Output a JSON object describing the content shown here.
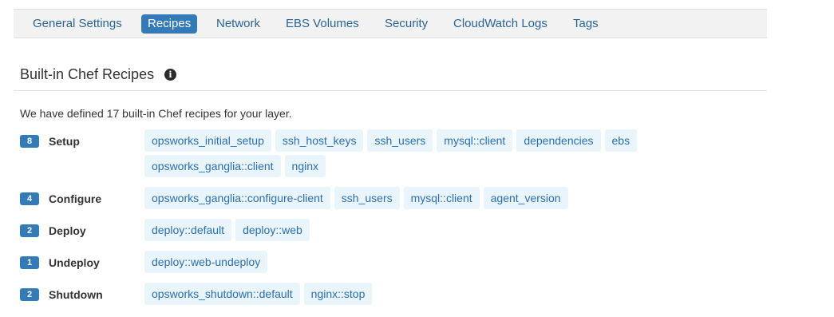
{
  "tabs": [
    {
      "label": "General Settings",
      "active": false
    },
    {
      "label": "Recipes",
      "active": true
    },
    {
      "label": "Network",
      "active": false
    },
    {
      "label": "EBS Volumes",
      "active": false
    },
    {
      "label": "Security",
      "active": false
    },
    {
      "label": "CloudWatch Logs",
      "active": false
    },
    {
      "label": "Tags",
      "active": false
    }
  ],
  "section": {
    "title": "Built-in Chef Recipes",
    "info_icon": "info-circle-icon",
    "info_glyph": "i",
    "description": "We have defined 17 built-in Chef recipes for your layer."
  },
  "lifecycle_events": [
    {
      "count": "8",
      "name": "Setup",
      "recipes": [
        "opsworks_initial_setup",
        "ssh_host_keys",
        "ssh_users",
        "mysql::client",
        "dependencies",
        "ebs",
        "opsworks_ganglia::client",
        "nginx"
      ]
    },
    {
      "count": "4",
      "name": "Configure",
      "recipes": [
        "opsworks_ganglia::configure-client",
        "ssh_users",
        "mysql::client",
        "agent_version"
      ]
    },
    {
      "count": "2",
      "name": "Deploy",
      "recipes": [
        "deploy::default",
        "deploy::web"
      ]
    },
    {
      "count": "1",
      "name": "Undeploy",
      "recipes": [
        "deploy::web-undeploy"
      ]
    },
    {
      "count": "2",
      "name": "Shutdown",
      "recipes": [
        "opsworks_shutdown::default",
        "nginx::stop"
      ]
    }
  ],
  "colors": {
    "accent": "#337ab7",
    "link": "#2a6fb0",
    "chip_background": "#eaf4fb",
    "tabbar_background": "#f2f2f2"
  }
}
